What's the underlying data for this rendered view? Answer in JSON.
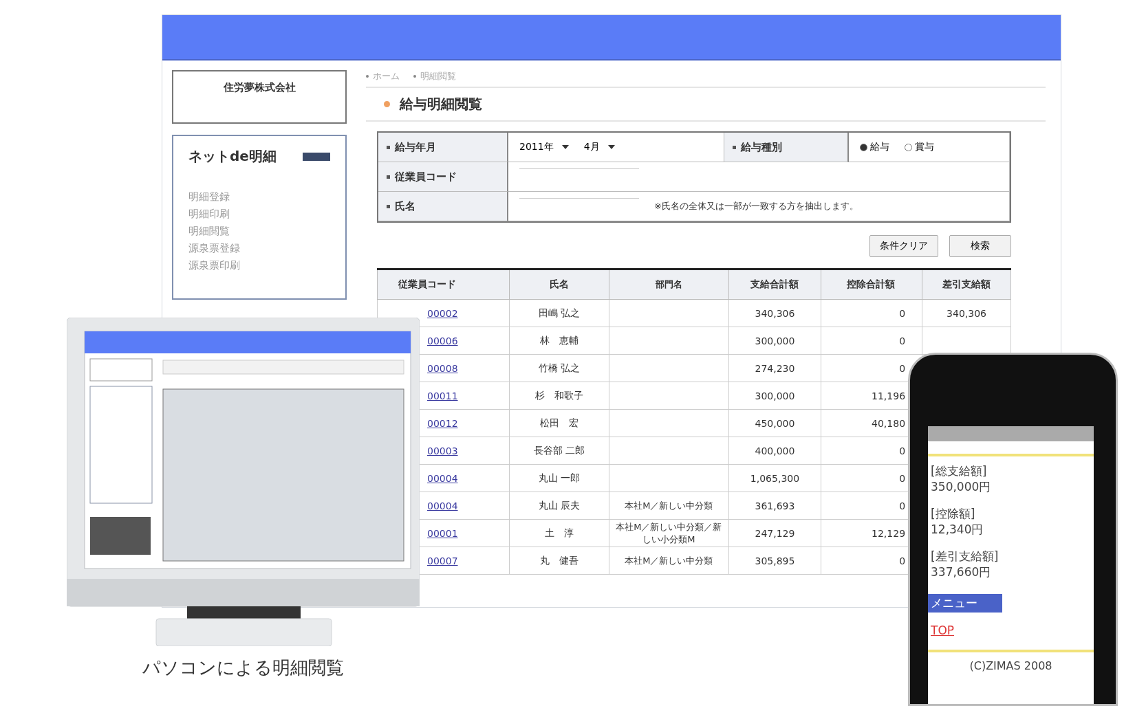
{
  "header": {
    "kind": "bar"
  },
  "sidebar": {
    "company": "住労夢株式会社",
    "logo": "ネットde明細",
    "items": [
      {
        "label": "明細登録"
      },
      {
        "label": "明細印刷"
      },
      {
        "label": "明細閲覧"
      },
      {
        "label": "源泉票登録"
      },
      {
        "label": "源泉票印刷"
      }
    ]
  },
  "breadcrumb": [
    "ホーム",
    "明細閲覧"
  ],
  "page_title": "給与明細閲覧",
  "search_form": {
    "pay_month_label": "給与年月",
    "year": "2011年",
    "month": "4月",
    "pay_type_label": "給与種別",
    "pay_types": [
      {
        "label": "給与",
        "selected": true
      },
      {
        "label": "賞与",
        "selected": false
      }
    ],
    "code_label": "従業員コード",
    "name_label": "氏名",
    "name_note": "※氏名の全体又は一部が一致する方を抽出します。",
    "buttons": [
      "条件クリア",
      "検索"
    ]
  },
  "table": {
    "columns": [
      "従業員コード",
      "氏名",
      "部門名",
      "支給合計額",
      "控除合計額",
      "差引支給額"
    ],
    "rows": [
      {
        "code": "00002",
        "name": "田嶋 弘之",
        "dept": "",
        "total": "340,306",
        "deduction": "0",
        "net": "340,306"
      },
      {
        "code": "00006",
        "name": "林　恵輔",
        "dept": "",
        "total": "300,000",
        "deduction": "0"
      },
      {
        "code": "00008",
        "name": "竹橋 弘之",
        "dept": "",
        "total": "274,230",
        "deduction": "0"
      },
      {
        "code": "00011",
        "name": "杉　和歌子",
        "dept": "",
        "total": "300,000",
        "deduction": "11,196"
      },
      {
        "code": "00012",
        "name": "松田　宏",
        "dept": "",
        "total": "450,000",
        "deduction": "40,180"
      },
      {
        "code": "00003",
        "name": "長谷部 二郎",
        "dept": "",
        "total": "400,000",
        "deduction": "0"
      },
      {
        "code": "00004",
        "name": "丸山 一郎",
        "dept": "",
        "total": "1,065,300",
        "deduction": "0"
      },
      {
        "code": "00004",
        "name": "丸山 辰夫",
        "dept": "本社M／新しい中分類",
        "total": "361,693",
        "deduction": "0"
      },
      {
        "code": "00001",
        "name": "土　淳",
        "dept": "本社M／新しい中分類／新しい小分類M",
        "total": "247,129",
        "deduction": "12,129"
      },
      {
        "code": "00007",
        "name": "丸　健吾",
        "dept": "本社M／新しい中分類",
        "total": "305,895",
        "deduction": "0"
      }
    ]
  },
  "monitor": {
    "caption": "パソコンによる明細閲覧"
  },
  "phone": {
    "lines": [
      "[総支給額]",
      "350,000円",
      "[控除額]",
      "12,340円",
      "[差引支給額]",
      "337,660円"
    ],
    "menu_link": "メニュー",
    "top_link": "TOP",
    "footer": "(C)ZIMAS 2008"
  }
}
